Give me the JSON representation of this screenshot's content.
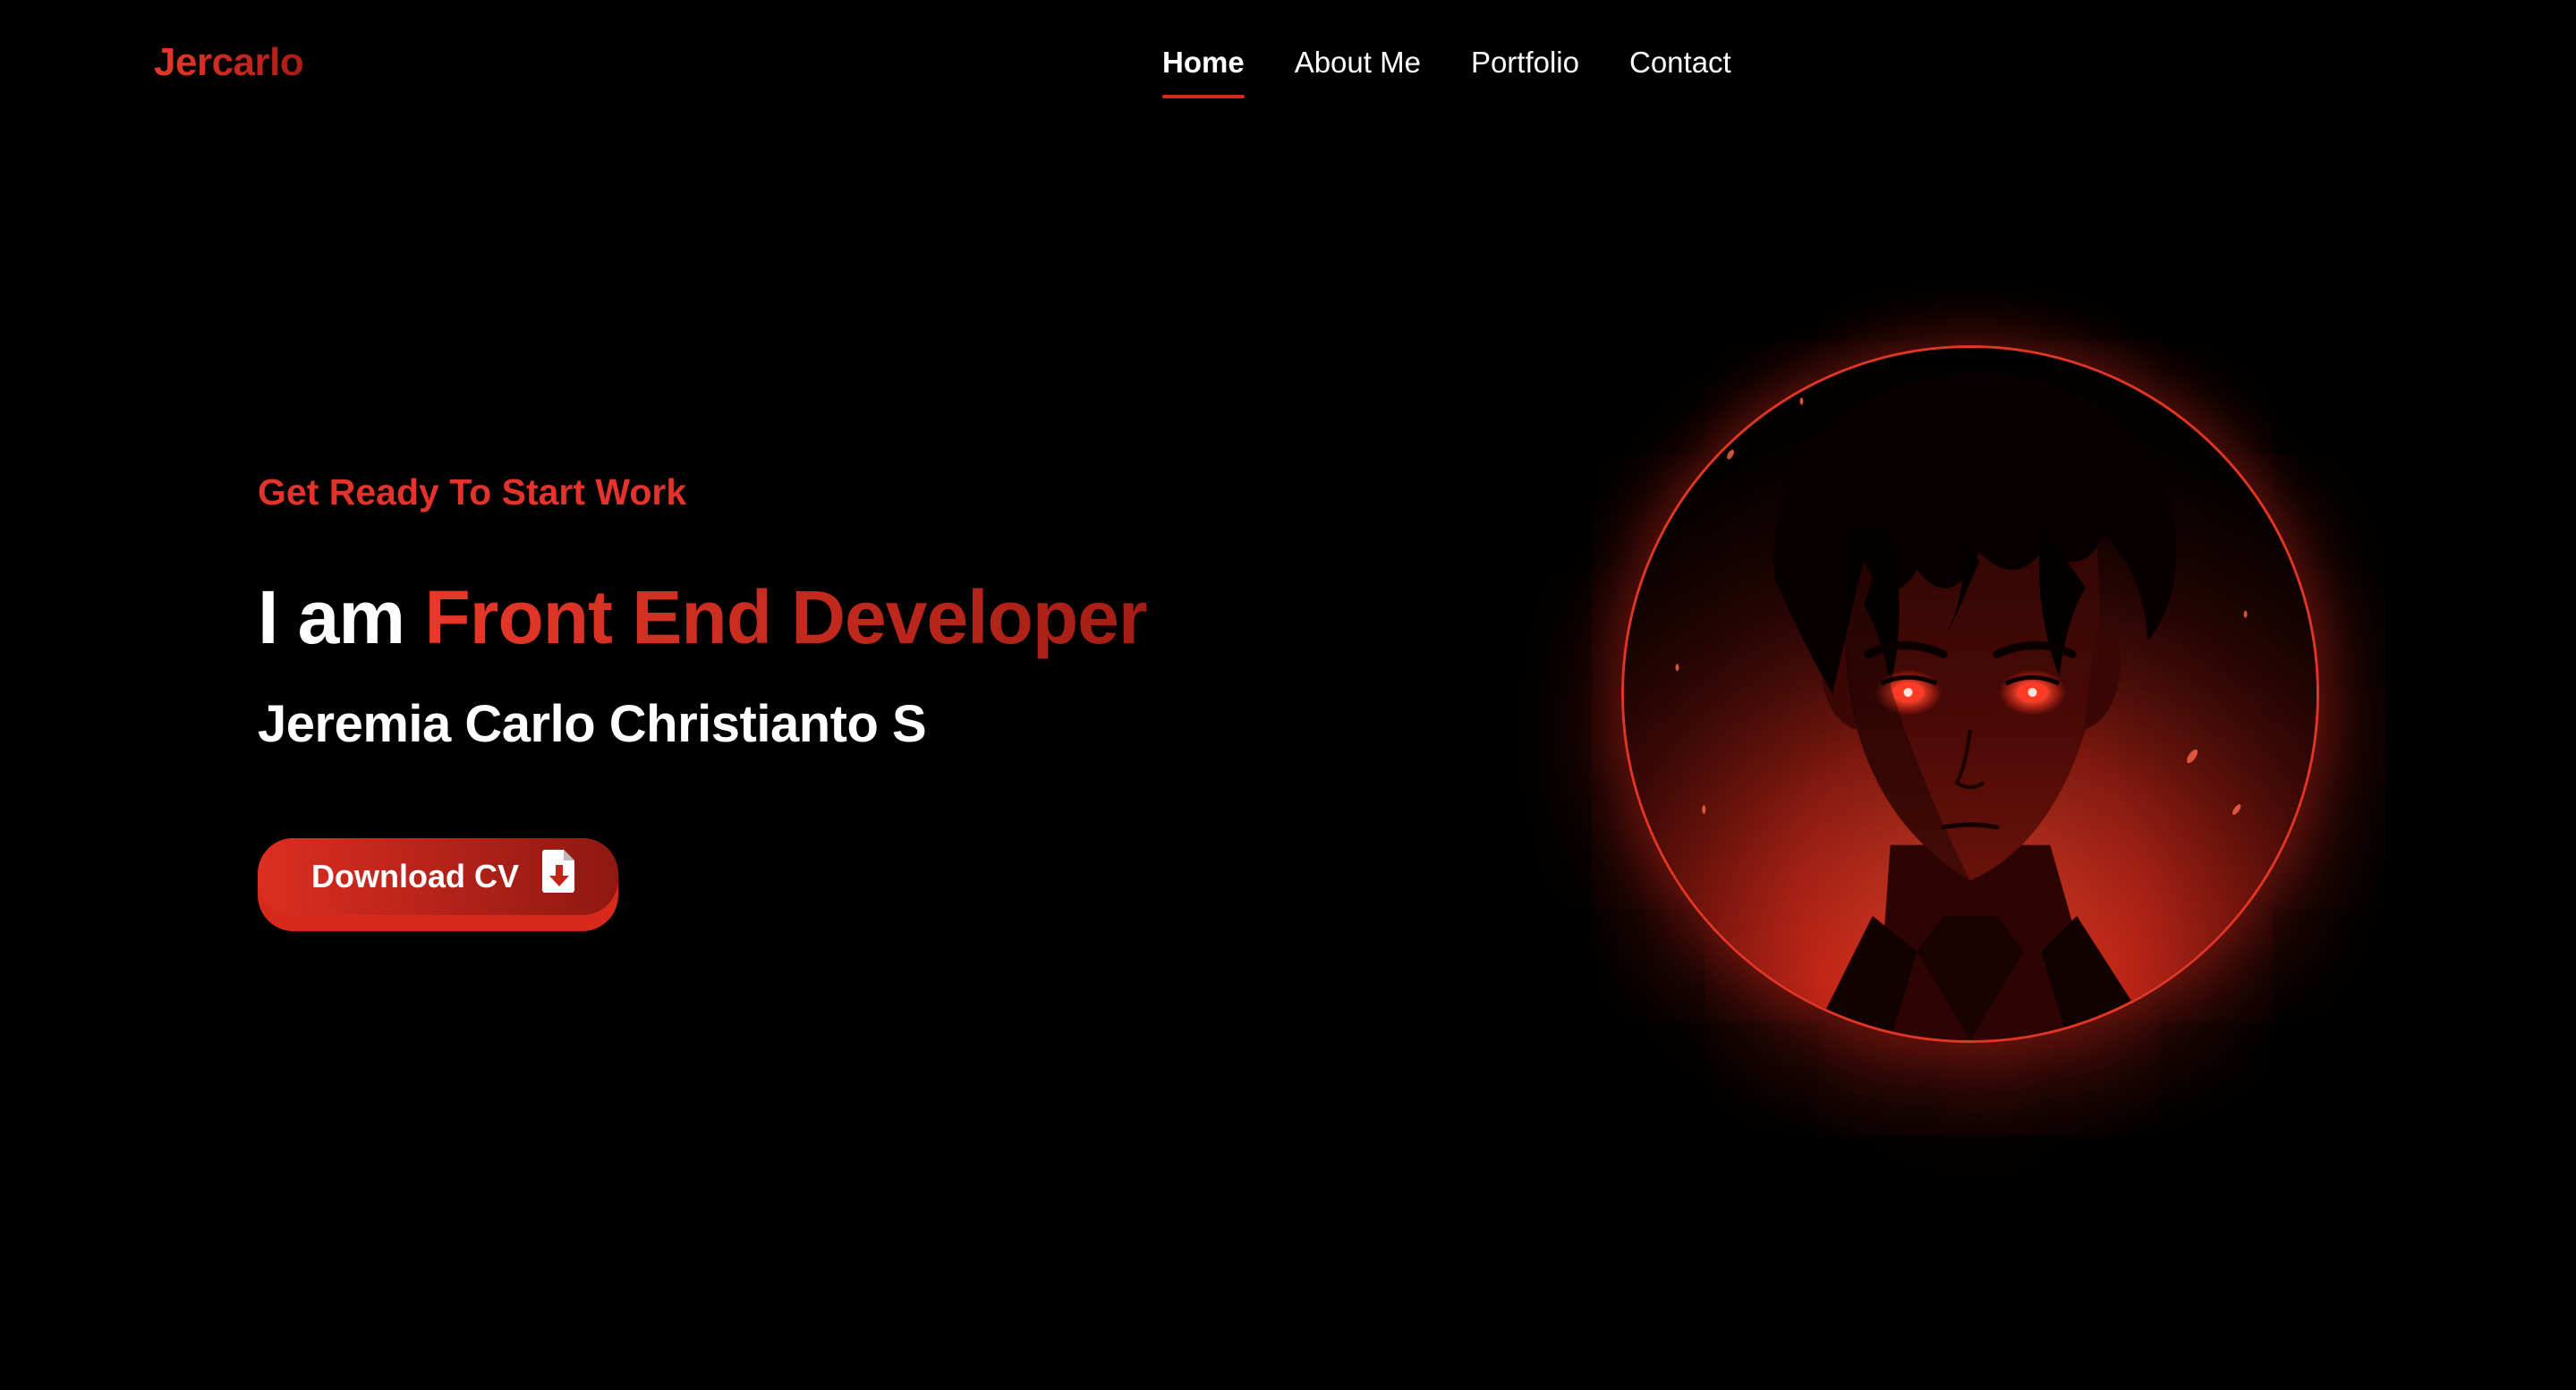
{
  "navbar": {
    "logo": "Jercarlo",
    "links": [
      {
        "label": "Home",
        "active": true
      },
      {
        "label": "About Me",
        "active": false
      },
      {
        "label": "Portfolio",
        "active": false
      },
      {
        "label": "Contact",
        "active": false
      }
    ]
  },
  "hero": {
    "tagline": "Get Ready To Start Work",
    "headline_prefix": "I am",
    "headline_role": "Front End Developer",
    "name": "Jeremia Carlo Christianto S",
    "download_button": {
      "label": "Download CV",
      "icon": "file-download-icon"
    },
    "portrait": {
      "icon": "anime-portrait-illustration"
    }
  },
  "colors": {
    "background": "#000000",
    "accent": "#e3332a",
    "accent_dark": "#a31d14",
    "text": "#ffffff"
  }
}
